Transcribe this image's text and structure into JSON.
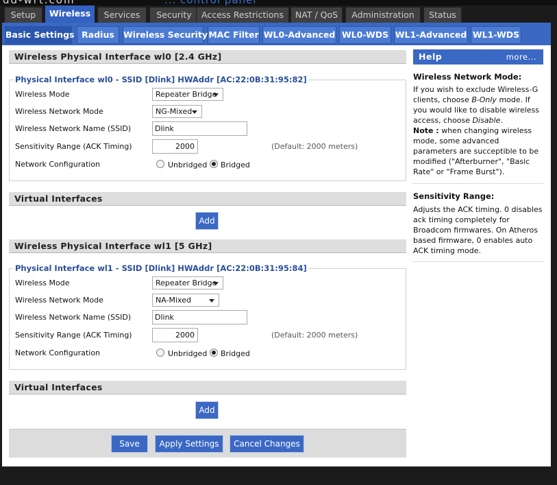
{
  "main_tabs": [
    "Setup",
    "Wireless",
    "Services",
    "Security",
    "Access Restrictions",
    "NAT / QoS",
    "Administration",
    "Status"
  ],
  "sub_tabs": [
    "Basic Settings",
    "Radius",
    "Wireless Security",
    "MAC Filter",
    "WL0-Advanced",
    "WL0-WDS",
    "WL1-Advanced",
    "WL1-WDS"
  ],
  "wl0": {
    "section_title": "Wireless Physical Interface wl0 [2.4 GHz]",
    "legend": "Physical Interface wl0 - SSID [Dlink] HWAddr [AC:22:0B:31:95:82]",
    "wireless_mode_label": "Wireless Mode",
    "wireless_mode": "Repeater Bridge",
    "network_mode_label": "Wireless Network Mode",
    "network_mode": "NG-Mixed",
    "ssid_label": "Wireless Network Name (SSID)",
    "ssid": "Dlink",
    "sensitivity_label": "Sensitivity Range (ACK Timing)",
    "sensitivity": "2000",
    "sensitivity_hint": "(Default: 2000 meters)",
    "netconf_label": "Network Configuration",
    "unbridged": "Unbridged",
    "bridged": "Bridged",
    "selected": "Bridged"
  },
  "virtual_interfaces_title": "Virtual Interfaces",
  "add_label": "Add",
  "wl1": {
    "section_title": "Wireless Physical Interface wl1 [5 GHz]",
    "legend": "Physical Interface wl1 - SSID [Dlink] HWAddr [AC:22:0B:31:95:84]",
    "wireless_mode_label": "Wireless Mode",
    "wireless_mode": "Repeater Bridge",
    "network_mode_label": "Wireless Network Mode",
    "network_mode": "NA-Mixed",
    "ssid_label": "Wireless Network Name (SSID)",
    "ssid": "Dlink",
    "sensitivity_label": "Sensitivity Range (ACK Timing)",
    "sensitivity": "2000",
    "sensitivity_hint": "(Default: 2000 meters)",
    "netconf_label": "Network Configuration",
    "unbridged": "Unbridged",
    "bridged": "Bridged",
    "selected": "Bridged"
  },
  "actions": {
    "save": "Save",
    "apply": "Apply Settings",
    "cancel": "Cancel Changes"
  },
  "help": {
    "title": "Help",
    "more": "more...",
    "mode_title": "Wireless Network Mode:",
    "mode_text_1": "If you wish to exclude Wireless-G clients, choose ",
    "mode_text_bonly": "B-Only",
    "mode_text_2": " mode. If you would like to disable wireless access, choose ",
    "mode_text_disable": "Disable",
    "mode_text_3": ".",
    "note_label": "Note :",
    "note_text": " when changing wireless mode, some advanced parameters are succeptible to be modified (\"Afterburner\", \"Basic Rate\" or \"Frame Burst\").",
    "sens_title": "Sensitivity Range:",
    "sens_text": "Adjusts the ACK timing. 0 disables ack timing completely for Broadcom firmwares. On Atheros based firmware, 0 enables auto ACK timing mode."
  },
  "colors": {
    "accent": "#3a68c3",
    "legend": "#2a4f9a",
    "background": "#1b1b1b"
  }
}
